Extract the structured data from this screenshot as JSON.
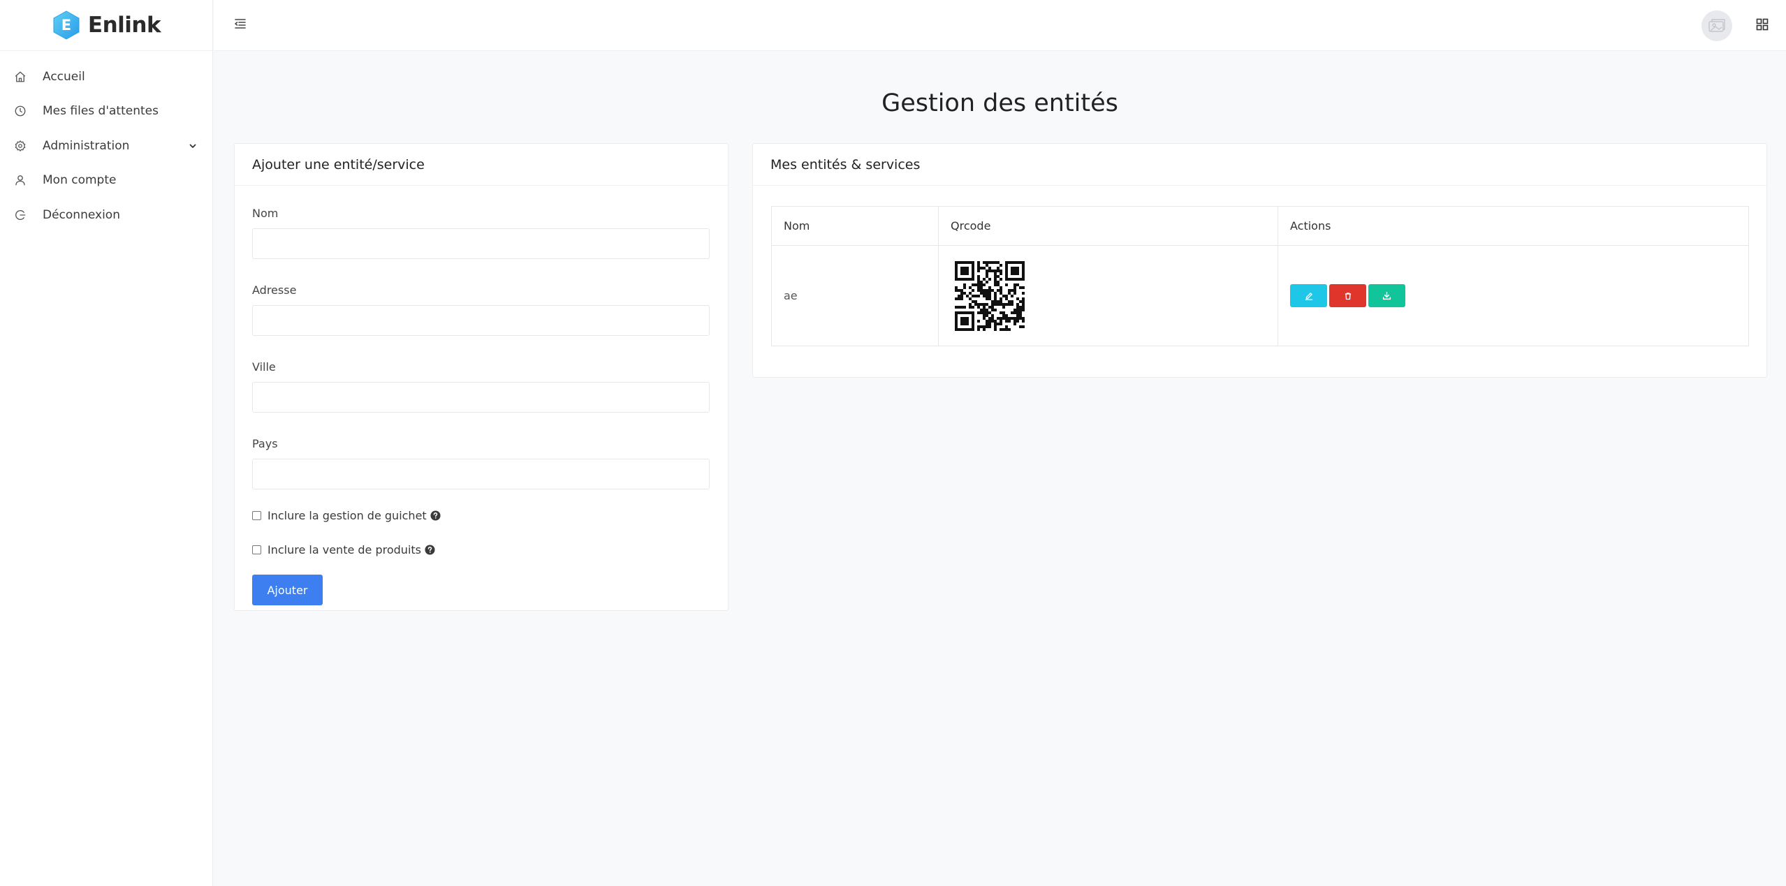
{
  "app": {
    "brand_initial": "E",
    "brand_name": "Enlink"
  },
  "sidebar": {
    "items": [
      {
        "label": "Accueil",
        "icon": "home-icon"
      },
      {
        "label": "Mes files d'attentes",
        "icon": "clock-icon"
      },
      {
        "label": "Administration",
        "icon": "gear-icon",
        "has_submenu": true
      },
      {
        "label": "Mon compte",
        "icon": "user-icon"
      },
      {
        "label": "Déconnexion",
        "icon": "logout-icon"
      }
    ]
  },
  "header": {
    "menu_icon": "menu-toggle-icon",
    "avatar_icon": "avatar",
    "apps_icon": "grid-icon"
  },
  "page": {
    "title": "Gestion des entités"
  },
  "form": {
    "title": "Ajouter une entité/service",
    "fields": [
      {
        "label": "Nom",
        "value": ""
      },
      {
        "label": "Adresse",
        "value": ""
      },
      {
        "label": "Ville",
        "value": ""
      },
      {
        "label": "Pays",
        "value": ""
      }
    ],
    "checkboxes": [
      {
        "label": "Inclure la gestion de guichet",
        "checked": false
      },
      {
        "label": "Inclure la vente de produits",
        "checked": false
      }
    ],
    "submit_label": "Ajouter"
  },
  "list": {
    "title": "Mes entités & services",
    "columns": [
      "Nom",
      "Qrcode",
      "Actions"
    ],
    "rows": [
      {
        "nom": "ae",
        "qrcode": "qr-code-image",
        "actions": [
          "edit-icon",
          "trash-icon",
          "download-icon"
        ]
      }
    ]
  },
  "colors": {
    "primary": "#3d7ff0",
    "edit": "#1ec6e8",
    "delete": "#e0352b",
    "download": "#12c49a",
    "logo": "#3ab8f0"
  }
}
